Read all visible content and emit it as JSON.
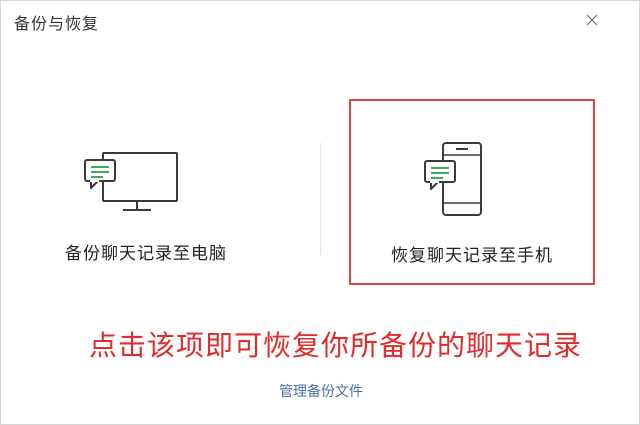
{
  "window": {
    "title": "备份与恢复"
  },
  "options": {
    "backup_to_pc": {
      "label": "备份聊天记录至电脑",
      "icon": "monitor-chat-icon"
    },
    "restore_to_phone": {
      "label": "恢复聊天记录至手机",
      "icon": "phone-chat-icon"
    }
  },
  "annotation": {
    "text": "点击该项即可恢复你所备份的聊天记录",
    "color": "#e32a2a"
  },
  "footer": {
    "manage_label": "管理备份文件"
  },
  "colors": {
    "accent_green": "#3fae5a",
    "highlight_red": "#e24444",
    "link_blue": "#4a6fa8"
  }
}
